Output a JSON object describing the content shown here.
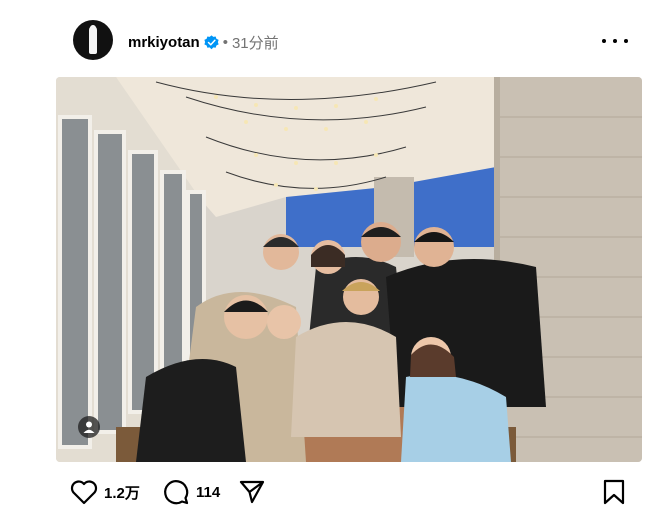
{
  "post": {
    "username": "mrkiyotan",
    "separator": "•",
    "time": "31分前",
    "verified_color": "#0095f6"
  },
  "photo": {
    "description_icon": "person-tag-icon"
  },
  "actions": {
    "like_count": "1.2万",
    "comment_count": "114"
  },
  "icons": {
    "like": "heart-icon",
    "comment": "comment-icon",
    "share": "send-icon",
    "save": "bookmark-icon",
    "more": "more-dots-icon"
  }
}
